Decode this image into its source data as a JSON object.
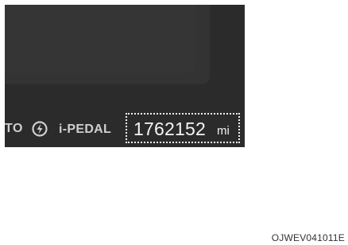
{
  "cluster": {
    "auto_label": "TO",
    "auto_icon": "auto-hold-icon",
    "ipedal_label": "i-PEDAL",
    "odometer_value": "1762152",
    "odometer_unit": "mi"
  },
  "figure": {
    "code": "OJWEV041011E"
  },
  "colors": {
    "panel": "#2b2b2b",
    "text_dim": "#cfcfcf",
    "text_bright": "#f4f4f4"
  }
}
